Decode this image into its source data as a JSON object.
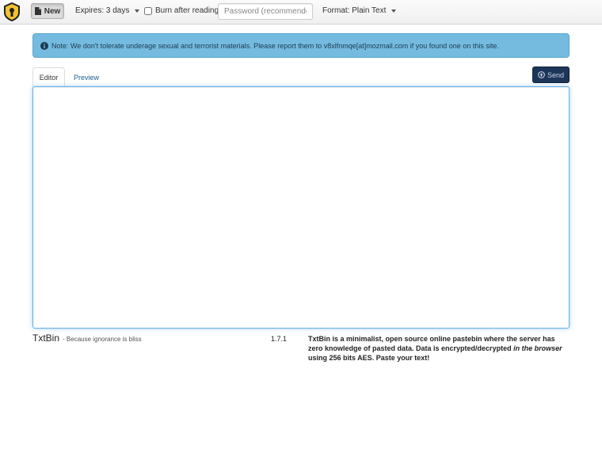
{
  "header": {
    "new_label": "New",
    "expires_label": "Expires: 3 days",
    "burn_label": "Burn after reading",
    "password_placeholder": "Password (recommended)",
    "format_label": "Format: Plain Text"
  },
  "alert": {
    "text": "Note: We don't tolerate underage sexual and terrorist materials. Please report them to v8xlfnmqe[at]mozmail.com if you found one on this site."
  },
  "tabs": [
    {
      "label": "Editor"
    },
    {
      "label": "Preview"
    }
  ],
  "send_label": "Send",
  "editor": {
    "value": ""
  },
  "footer": {
    "brand": "TxtBin",
    "tagline": "- Because ignorance is bliss",
    "version": "1.7.1",
    "about_before": "TxtBin is a minimalist, open source online pastebin where the server has zero knowledge of pasted data. Data is encrypted/decrypted ",
    "about_em": "in the browser",
    "about_after": " using 256 bits AES. Paste your text!"
  },
  "colors": {
    "alert_bg": "#75bbe0",
    "send_bg": "#1c3558",
    "logo_yellow": "#f2c230",
    "link": "#1b5d96"
  },
  "icons": {
    "logo": "keyhole-shield-icon",
    "new": "document-icon",
    "alert": "info-circle-icon",
    "send": "upload-circle-icon"
  }
}
